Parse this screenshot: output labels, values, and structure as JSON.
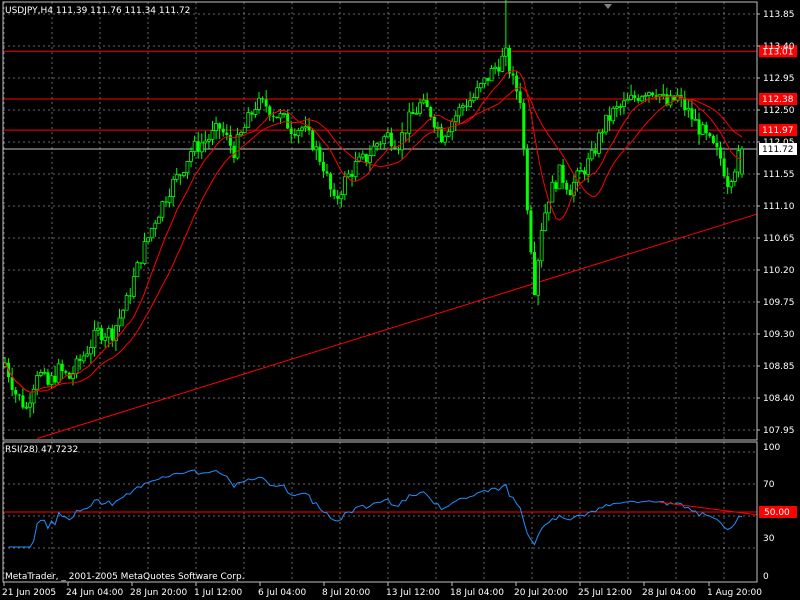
{
  "window": {
    "symbol_header": "USDJPY,H4  111.39 111.76 111.34 111.72",
    "copyright": "MetaTrader, _ 2001-2005 MetaQuotes Software Corp."
  },
  "colors": {
    "background": "#000000",
    "frame": "#c0c0c0",
    "grid": "#c0c0c0",
    "candle": "#00ff00",
    "ma": "#ff0000",
    "hline": "#ff0000",
    "trendline": "#ff0000",
    "rsi": "#1e90ff",
    "text": "#ffffff",
    "price_tag_bg": "#ff0000",
    "bid_tag_bg": "#ffffff",
    "bid_tag_text": "#000000"
  },
  "chart_data": {
    "type": "candlestick",
    "symbol": "USDJPY",
    "timeframe": "H4",
    "last_ohlc": {
      "open": 111.39,
      "high": 111.76,
      "low": 111.34,
      "close": 111.72
    },
    "ylim": [
      107.88,
      113.66
    ],
    "y_ticks": [
      "113.85",
      "113.40",
      "112.95",
      "112.50",
      "112.05",
      "111.55",
      "111.10",
      "110.65",
      "110.20",
      "109.75",
      "109.30",
      "108.85",
      "108.40",
      "107.95"
    ],
    "x_tick_labels": [
      "21 Jun 2005",
      "24 Jun 04:00",
      "28 Jun 20:00",
      "1 Jul 12:00",
      "6 Jul 04:00",
      "8 Jul 20:00",
      "13 Jul 12:00",
      "18 Jul 04:00",
      "20 Jul 20:00",
      "25 Jul 12:00",
      "28 Jul 04:00",
      "1 Aug 20:00"
    ],
    "horizontal_lines": [
      {
        "price": 113.01,
        "label": "113.01"
      },
      {
        "price": 112.38,
        "label": "112.38"
      },
      {
        "price": 111.97,
        "label": "111.97"
      }
    ],
    "bid_line": {
      "price": 111.72,
      "label": "111.72"
    },
    "trendline": {
      "from_price": 107.9,
      "to_price": 110.8,
      "from_index": 9,
      "to_index": 206
    },
    "close_anchors": [
      [
        0,
        108.9
      ],
      [
        3,
        108.5
      ],
      [
        6,
        108.3
      ],
      [
        9,
        108.8
      ],
      [
        12,
        108.6
      ],
      [
        15,
        108.8
      ],
      [
        18,
        108.7
      ],
      [
        22,
        109.0
      ],
      [
        26,
        109.3
      ],
      [
        30,
        109.3
      ],
      [
        34,
        109.7
      ],
      [
        38,
        110.3
      ],
      [
        42,
        110.8
      ],
      [
        46,
        111.2
      ],
      [
        49,
        111.4
      ],
      [
        52,
        111.7
      ],
      [
        55,
        111.8
      ],
      [
        58,
        111.9
      ],
      [
        60,
        112.0
      ],
      [
        64,
        111.7
      ],
      [
        67,
        112.0
      ],
      [
        70,
        112.3
      ],
      [
        73,
        112.3
      ],
      [
        75,
        112.2
      ],
      [
        78,
        112.1
      ],
      [
        80,
        112.0
      ],
      [
        83,
        112.0
      ],
      [
        86,
        111.8
      ],
      [
        89,
        111.5
      ],
      [
        92,
        111.0
      ],
      [
        95,
        111.3
      ],
      [
        98,
        111.5
      ],
      [
        101,
        111.6
      ],
      [
        104,
        111.8
      ],
      [
        107,
        111.9
      ],
      [
        110,
        111.8
      ],
      [
        113,
        112.1
      ],
      [
        116,
        112.3
      ],
      [
        119,
        112.2
      ],
      [
        122,
        111.9
      ],
      [
        125,
        112.1
      ],
      [
        128,
        112.3
      ],
      [
        131,
        112.4
      ],
      [
        134,
        112.6
      ],
      [
        137,
        112.8
      ],
      [
        140,
        112.95
      ],
      [
        142,
        112.6
      ],
      [
        144,
        112.4
      ],
      [
        146,
        111.0
      ],
      [
        148,
        109.9
      ],
      [
        150,
        110.7
      ],
      [
        152,
        111.1
      ],
      [
        155,
        111.4
      ],
      [
        158,
        111.2
      ],
      [
        161,
        111.4
      ],
      [
        164,
        111.6
      ],
      [
        167,
        112.0
      ],
      [
        170,
        112.2
      ],
      [
        173,
        112.3
      ],
      [
        176,
        112.4
      ],
      [
        179,
        112.5
      ],
      [
        182,
        112.5
      ],
      [
        185,
        112.3
      ],
      [
        188,
        112.4
      ],
      [
        191,
        112.2
      ],
      [
        194,
        112.0
      ],
      [
        197,
        111.8
      ],
      [
        200,
        111.6
      ],
      [
        202,
        111.3
      ],
      [
        204,
        111.5
      ],
      [
        206,
        111.72
      ]
    ],
    "candle_count": 207,
    "ma_periods": [
      10,
      20
    ],
    "rsi": {
      "label": "RSI(28) 47.7232",
      "period": 28,
      "value": 47.7232,
      "ylim": [
        0,
        100
      ],
      "y_ticks": [
        "100",
        "70",
        "50.00",
        "30",
        "0"
      ],
      "level": 50,
      "trendline": {
        "from_index": 183,
        "from_value": 57,
        "to_index": 206,
        "to_value": 48
      }
    }
  }
}
